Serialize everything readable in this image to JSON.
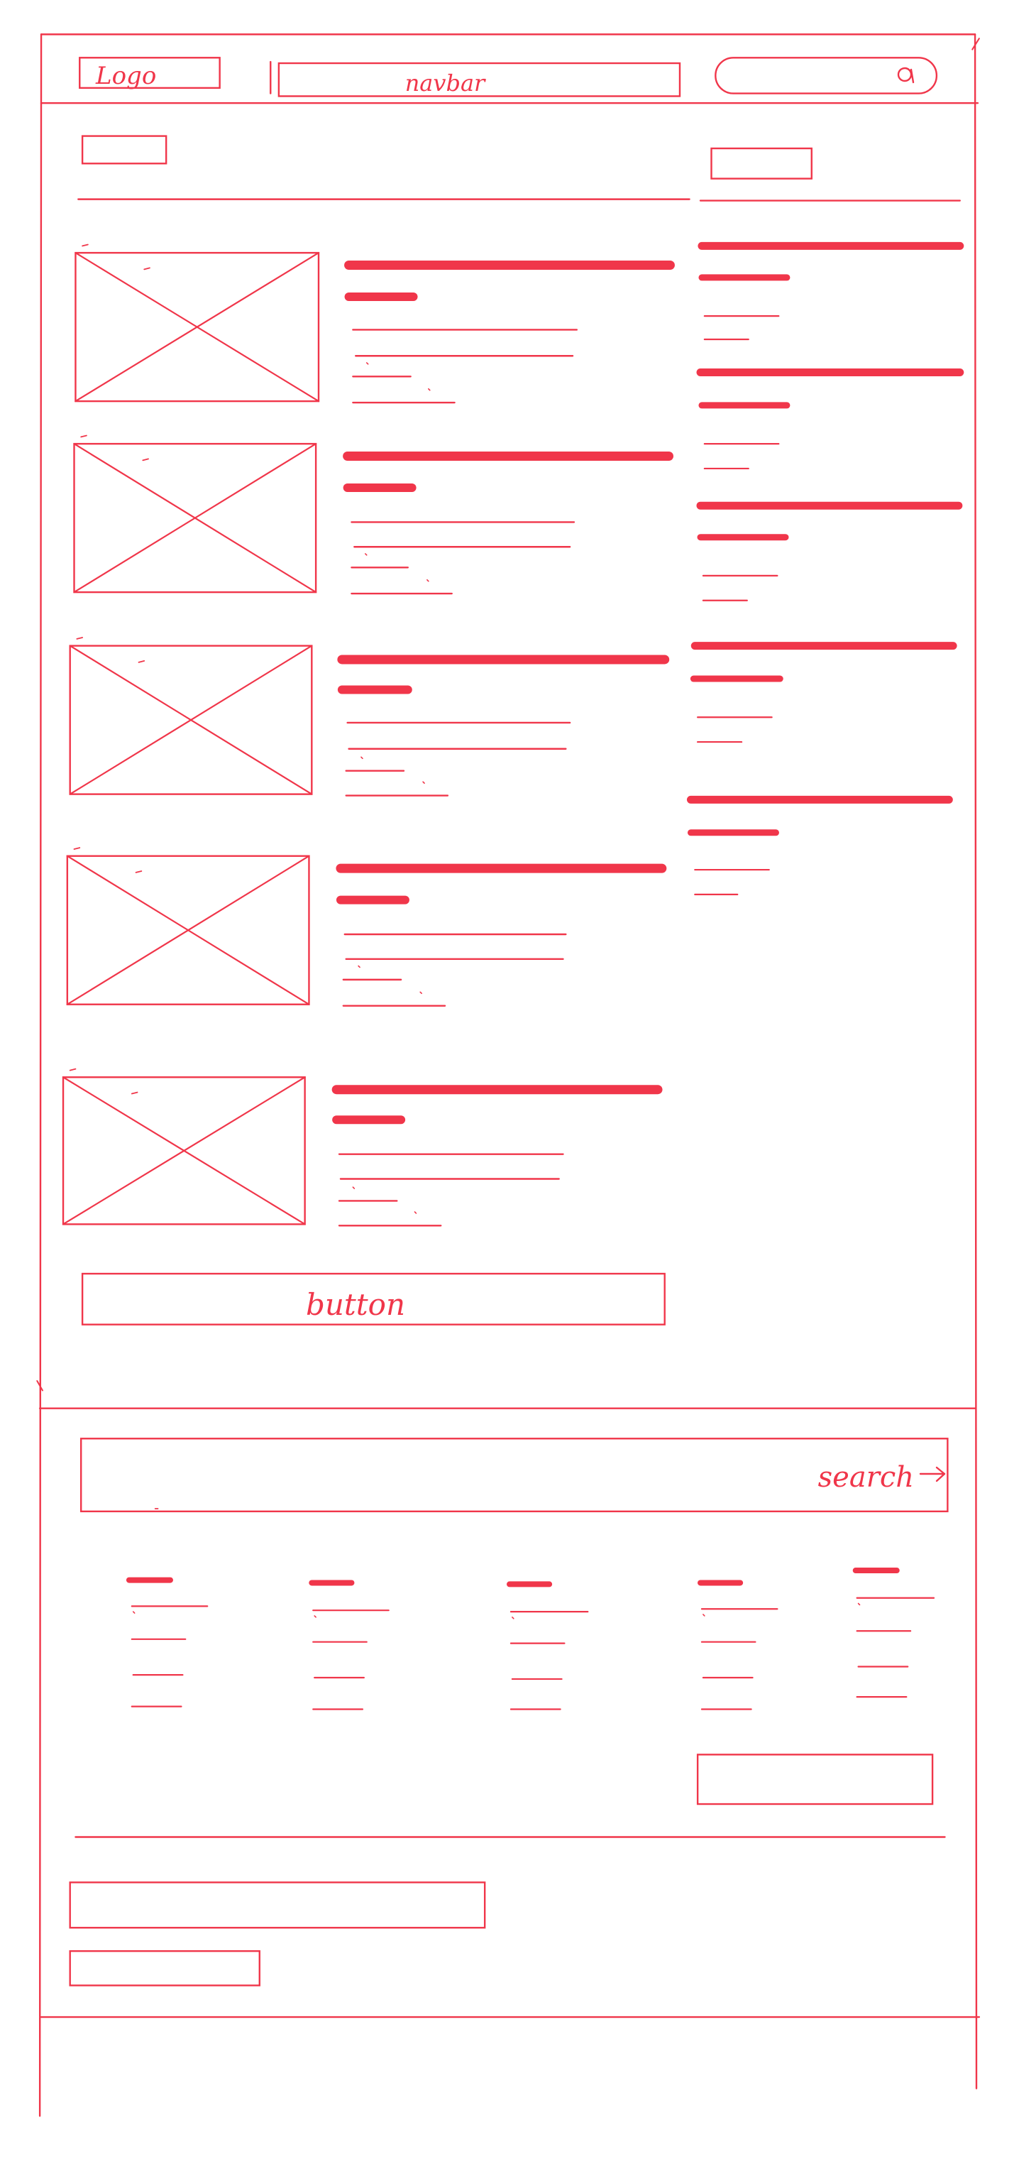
{
  "theme": {
    "stroke": "#f0364a",
    "background": "#ffffff"
  },
  "header": {
    "logo_label": "Logo",
    "navbar_label": "navbar",
    "search_icon": "search-icon"
  },
  "main": {
    "button_label": "button"
  },
  "footer": {
    "search_label": "search",
    "search_arrow_icon": "arrow-right-icon"
  }
}
